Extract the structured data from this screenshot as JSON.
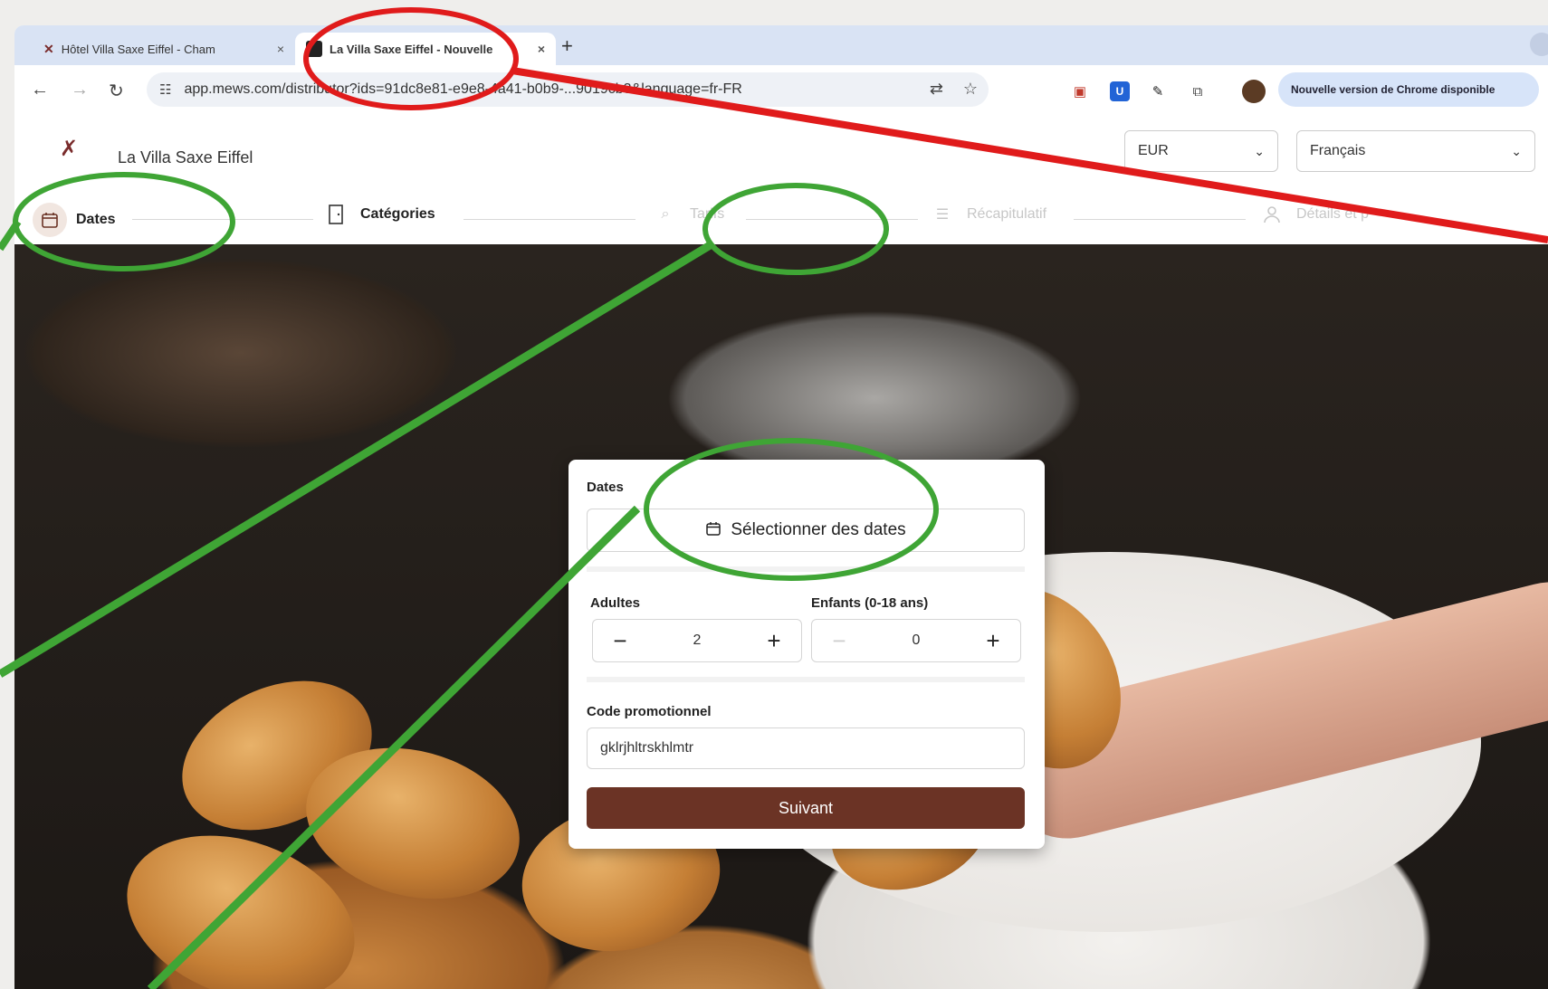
{
  "browser": {
    "tabs": [
      {
        "title": "Hôtel Villa Saxe Eiffel - Cham",
        "close": "×"
      },
      {
        "title": "La Villa Saxe Eiffel - Nouvelle",
        "close": "×"
      }
    ],
    "new_tab": "+",
    "url": "app.mews.com/distributor?ids=91dc8e81-e9e8-4a41-b0b9-...9019cb3&language=fr-FR",
    "update_button": "Nouvelle version de Chrome disponible",
    "ext_badge": "U"
  },
  "site": {
    "hotel_name": "La Villa Saxe Eiffel",
    "currency": "EUR",
    "language": "Français"
  },
  "steps": [
    {
      "label": "Dates",
      "icon": "calendar-icon",
      "state": "current"
    },
    {
      "label": "Catégories",
      "icon": "door-icon",
      "state": "todo"
    },
    {
      "label": "Tarifs",
      "icon": "tag-icon",
      "state": "disabled"
    },
    {
      "label": "Récapitulatif",
      "icon": "list-icon",
      "state": "disabled"
    },
    {
      "label": "Détails et p",
      "icon": "person-icon",
      "state": "disabled"
    }
  ],
  "form": {
    "dates_label": "Dates",
    "select_dates": "Sélectionner des dates",
    "adults_label": "Adultes",
    "adults_value": "2",
    "children_label": "Enfants (0-18 ans)",
    "children_value": "0",
    "minus": "−",
    "plus": "+",
    "promo_label": "Code promotionnel",
    "promo_value": "gklrjhltrskhlmtr",
    "submit": "Suivant"
  },
  "colors": {
    "annotation_red": "#e01b1b",
    "annotation_green": "#3fa535",
    "brand": "#6b3325"
  }
}
